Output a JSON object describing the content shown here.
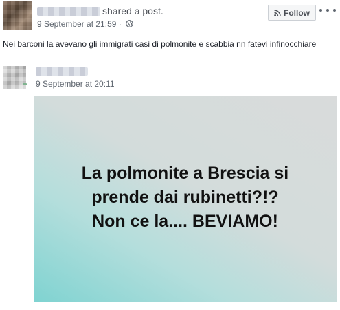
{
  "post": {
    "shared_label": "shared a post.",
    "timestamp": "9 September at 21:59 ·",
    "privacy_icon": "globe-icon",
    "follow_label": "Follow",
    "follow_icon": "rss-icon",
    "more_icon": "more-options-icon",
    "text": "Nei barconi la avevano gli immigrati casi di polmonite e scabbia nn fatevi infinocchiare"
  },
  "shared_post": {
    "timestamp": "9 September at 20:11",
    "image": {
      "lines": [
        "La polmonite a Brescia si",
        "prende dai rubinetti?!?",
        "Non ce la.... BEVIAMO!"
      ]
    }
  },
  "colors": {
    "image_gradient_start": "#7fd3d1",
    "image_gradient_end": "#d9dbdb",
    "meta_text": "#606770"
  }
}
